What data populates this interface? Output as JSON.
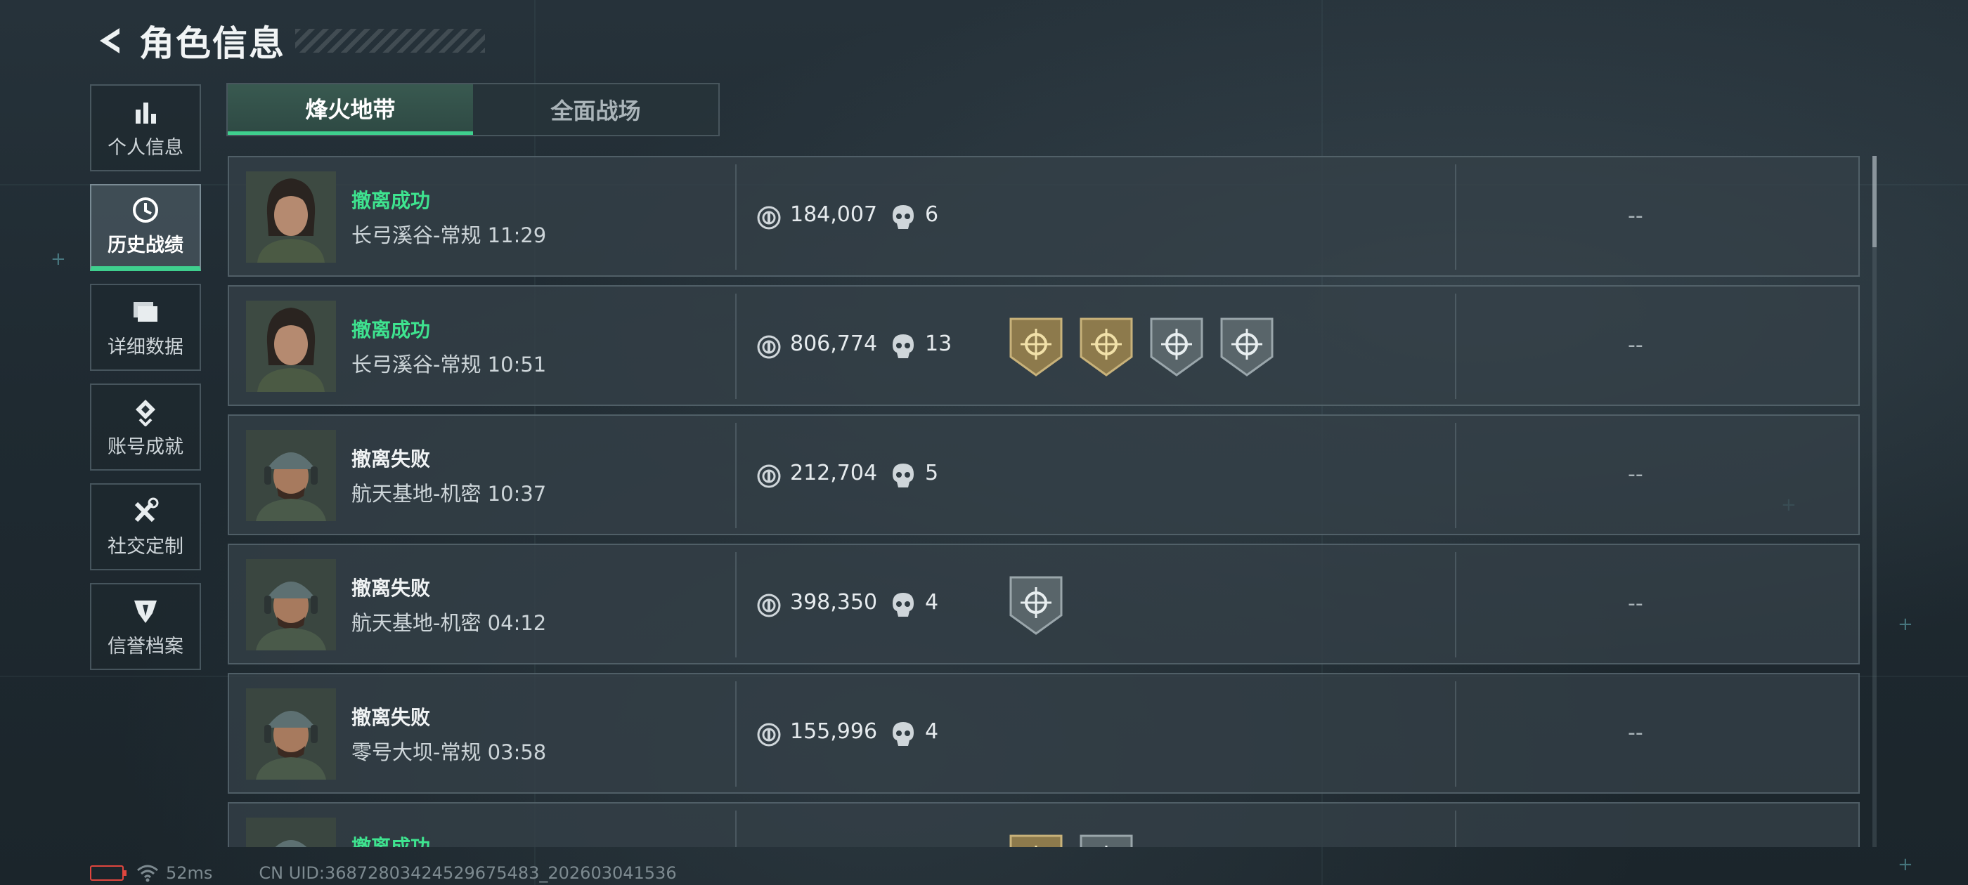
{
  "header": {
    "title": "角色信息"
  },
  "sidebar": {
    "items": [
      {
        "label": "个人信息",
        "icon": "bar-chart-icon",
        "active": false
      },
      {
        "label": "历史战绩",
        "icon": "clock-history-icon",
        "active": true
      },
      {
        "label": "详细数据",
        "icon": "folder-icon",
        "active": false
      },
      {
        "label": "账号成就",
        "icon": "achievement-icon",
        "active": false
      },
      {
        "label": "社交定制",
        "icon": "tools-icon",
        "active": false
      },
      {
        "label": "信誉档案",
        "icon": "shield-icon",
        "active": false
      }
    ]
  },
  "tabs": [
    {
      "label": "烽火地带",
      "active": true
    },
    {
      "label": "全面战场",
      "active": false
    }
  ],
  "matches": [
    {
      "result": "撤离成功",
      "status": "success",
      "map": "长弓溪谷-常规 11:29",
      "assets": "184,007",
      "kills": "6",
      "badges": [],
      "extra": "--",
      "operator": "female"
    },
    {
      "result": "撤离成功",
      "status": "success",
      "map": "长弓溪谷-常规 10:51",
      "assets": "806,774",
      "kills": "13",
      "badges": [
        {
          "icon": "sun-badge-icon",
          "tier": "gold"
        },
        {
          "icon": "face-badge-icon",
          "tier": "gold"
        },
        {
          "icon": "burst-badge-icon",
          "tier": "silver"
        },
        {
          "icon": "grenade-badge-icon",
          "tier": "silver"
        }
      ],
      "extra": "--",
      "operator": "female"
    },
    {
      "result": "撤离失败",
      "status": "fail",
      "map": "航天基地-机密 10:37",
      "assets": "212,704",
      "kills": "5",
      "badges": [],
      "extra": "--",
      "operator": "male"
    },
    {
      "result": "撤离失败",
      "status": "fail",
      "map": "航天基地-机密 04:12",
      "assets": "398,350",
      "kills": "4",
      "badges": [
        {
          "icon": "target-badge-icon",
          "tier": "silver"
        }
      ],
      "extra": "--",
      "operator": "male"
    },
    {
      "result": "撤离失败",
      "status": "fail",
      "map": "零号大坝-常规 03:58",
      "assets": "155,996",
      "kills": "4",
      "badges": [],
      "extra": "--",
      "operator": "male"
    },
    {
      "result": "撤离成功",
      "status": "success",
      "map": "",
      "assets": "",
      "kills": "",
      "badges": [
        {
          "icon": "gold-badge-icon",
          "tier": "gold"
        },
        {
          "icon": "silver-badge-icon",
          "tier": "silver"
        }
      ],
      "extra": "",
      "operator": "male"
    }
  ],
  "footer": {
    "ping": "52ms",
    "uid": "CN UID:36872803424529675483_202603041536"
  },
  "colors": {
    "success": "#3ee38f",
    "accent": "#3fcf8e",
    "battery": "#e0463e"
  }
}
